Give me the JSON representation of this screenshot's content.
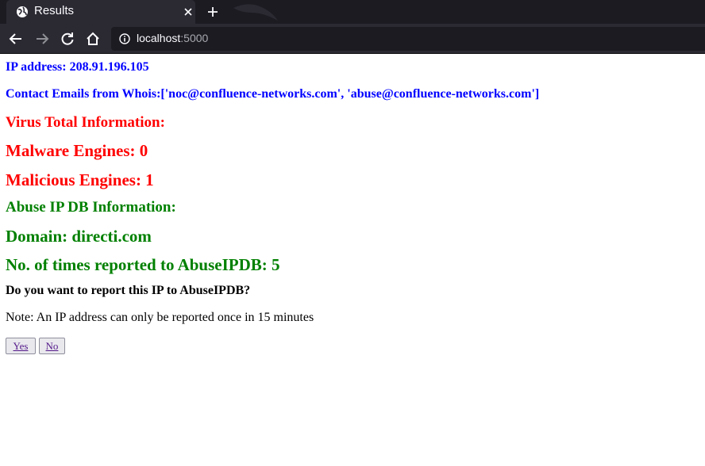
{
  "browser": {
    "tab_title": "Results",
    "url_host": "localhost",
    "url_port": ":5000"
  },
  "report": {
    "ip_line": "IP address: 208.91.196.105",
    "emails_line": "Contact Emails from Whois:['noc@confluence-networks.com', 'abuse@confluence-networks.com']",
    "vt_header": "Virus Total Information:",
    "malware_engines": "Malware Engines: 0",
    "malicious_engines": "Malicious Engines: 1",
    "abuse_header": "Abuse IP DB Information:",
    "domain": "Domain: directi.com",
    "times_reported": "No. of times reported to AbuseIPDB: 5",
    "question": "Do you want to report this IP to AbuseIPDB?",
    "note": "Note: An IP address can only be reported once in 15 minutes",
    "yes_label": "Yes",
    "no_label": "No"
  },
  "colors": {
    "blue_text": "#0000ff",
    "red_text": "#ff0000",
    "green_text": "#008000",
    "chrome_dark": "#1c1b22",
    "chrome_mid": "#2b2a33"
  }
}
